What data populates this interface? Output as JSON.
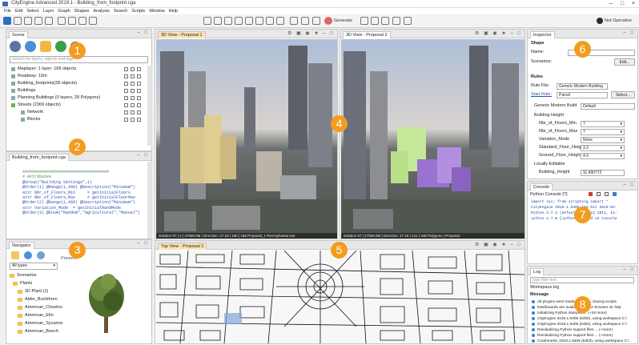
{
  "app": {
    "title": "CityEngine Advanced 2019.1 - Building_from_footprint.cga"
  },
  "menu": [
    "File",
    "Edit",
    "Select",
    "Layer",
    "Graph",
    "Shapes",
    "Analysis",
    "Search",
    "Scripts",
    "Window",
    "Help"
  ],
  "toolbar": {
    "generate": "Generate",
    "not_operative": "Not Operative"
  },
  "scene": {
    "tab": "Scene",
    "search_placeholder": "Search for layers, objects and tags",
    "items": [
      "Maplayer: 1 layer: 168 objects",
      "Roadway: 10m",
      "Building_footprints(28 objects)",
      "Buildings",
      "Planning Buildings (0 layers, 28 Polygons)",
      "Streets (2369 objects)",
      "Network",
      "Blocks"
    ]
  },
  "cga": {
    "tab": "Building_from_footprint.cga",
    "code": [
      "####################################",
      "# Attributes",
      "",
      "@Group(\"Building Settings\",1)",
      "",
      "@Order(1) @Range(1,400) @Description(\"Minimum\")",
      "attr Nbr_of_Floors_Min     = getInitialFloors",
      "attr Nbr_of_Floors_Max     = getInitialFloorMax",
      "@Order(2) @Range(1,400) @Description(\"Minimum\")",
      "attr Variation_Mode  = getInitialRandMode",
      "@Order(3) @Enum(\"Random\",\"Agricultural\",\"Manual\")"
    ]
  },
  "view1": {
    "tab": "3D View - Proposal 1",
    "info": "Solution 07 | 1 | 27506.0M | Direction: 27.18 | 160 | 159 Proposal_1 Pennsylvania Ave"
  },
  "view2": {
    "tab": "3D View - Proposal 2",
    "info": "Solution 07 | 27506.0M | Direction: 27.18 | 141 | 348 Polygons | Proposal"
  },
  "view3": {
    "tab": "Top View - Proposal 1"
  },
  "navigator": {
    "tab": "Navigator",
    "filter": "All types",
    "label": "Preview",
    "items": [
      "Scenarios",
      "Plants",
      "3D Plant (1)",
      "Alder_Buckthorn",
      "American_Chestnut",
      "American_Elm",
      "American_Sycamore",
      "American_Beech"
    ]
  },
  "inspector": {
    "tab": "Inspector",
    "shape": "Shape",
    "name_label": "Name:",
    "name_value": "",
    "scenarios_label": "Scenarios:",
    "edit": "Edit...",
    "rules_title": "Rules",
    "rule_file_label": "Rule File:",
    "rule_file": "Generic Modern Building",
    "start_rule_label": "Start Rule:",
    "start_rule": "Parcel",
    "select": "Select...",
    "section": "Generic Modern Build",
    "section_val": "Default",
    "building_height": "Building Height",
    "attrs": [
      {
        "k": "Nbr_of_Floors_Min",
        "v": "7"
      },
      {
        "k": "Nbr_of_Floors_Max",
        "v": "7"
      },
      {
        "k": "Variation_Mode",
        "v": "None"
      },
      {
        "k": "Standard_Floor_Height",
        "v": "3.3"
      },
      {
        "k": "Ground_Floor_Height",
        "v": "4.0"
      }
    ],
    "locally": "Locally Editable",
    "bh_label": "Building_Height",
    "bh_value": "11.490772"
  },
  "console": {
    "tab": "Console",
    "subtitle": "Python Console [?]",
    "lines": [
      "import sys; from scripting import *",
      "CityEngine 2019.1.9405 (64-bit 2019-04-",
      "Python 2.7.2 (default, Jun 12 2011, 14:",
      "Jython 2.7.0 [Jython] exited on console"
    ]
  },
  "log": {
    "tab": "Log",
    "filter_placeholder": "type filter text",
    "file": "Workspace.log",
    "msg_header": "Message",
    "lines": [
      "All plugins were loaded in 1.89...Saving scripts",
      "Dashboards are available in your browser at: http",
      "Initializing Python interpreter: (+16 more)",
      "CityEngine 2019.1.9405 (64bit), using workspace C:\\",
      "CityEngine 2019.1.9405 (64bit), using workspace C:\\",
      "Reinitializing Python support files ... (+more)",
      "Reinitializing Python support files ... (+more)",
      "Crashmetric 2019.1.9405 (64bit), using workspace C:\\"
    ]
  },
  "badges": [
    "1",
    "2",
    "3",
    "4",
    "5",
    "6",
    "7",
    "8"
  ]
}
